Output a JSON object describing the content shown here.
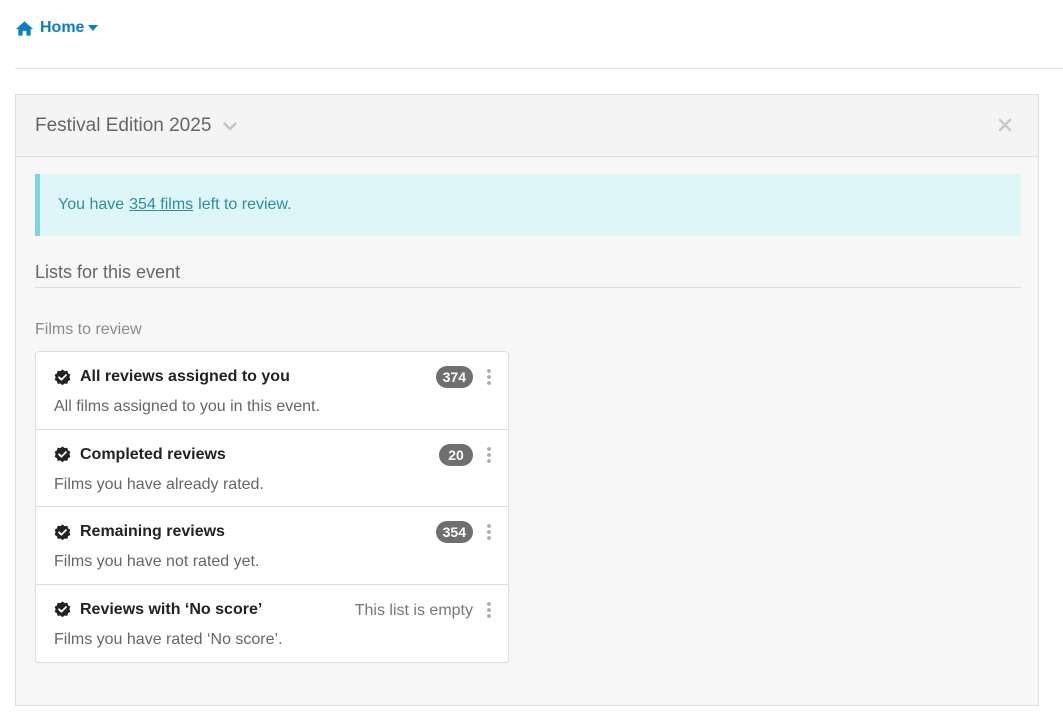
{
  "nav": {
    "home_label": "Home"
  },
  "panel": {
    "title": "Festival Edition 2025"
  },
  "alert": {
    "prefix": "You have",
    "link_text": "354 films",
    "suffix": "left to review."
  },
  "lists_heading": "Lists for this event",
  "section_label": "Films to review",
  "list_items": [
    {
      "title": "All reviews assigned to you",
      "description": "All films assigned to you in this event.",
      "count": "374"
    },
    {
      "title": "Completed reviews",
      "description": "Films you have already rated.",
      "count": "20"
    },
    {
      "title": "Remaining reviews",
      "description": "Films you have not rated yet.",
      "count": "354"
    },
    {
      "title": "Reviews with ‘No score’",
      "description": "Films you have rated ‘No score’.",
      "empty_text": "This list is empty"
    }
  ],
  "colors": {
    "link_blue": "#0b7dc2",
    "alert_bg": "#dff6f8",
    "alert_border": "#7ed3df",
    "alert_text": "#2b8f9c",
    "badge_bg": "#6f6f6f"
  },
  "icons": {
    "nav": "home-icon",
    "nav_caret": "caret-down-icon",
    "panel_toggle": "chevron-down-icon",
    "panel_close": "close-icon",
    "list_item": "verified-check-icon",
    "list_menu": "kebab-menu-icon"
  }
}
